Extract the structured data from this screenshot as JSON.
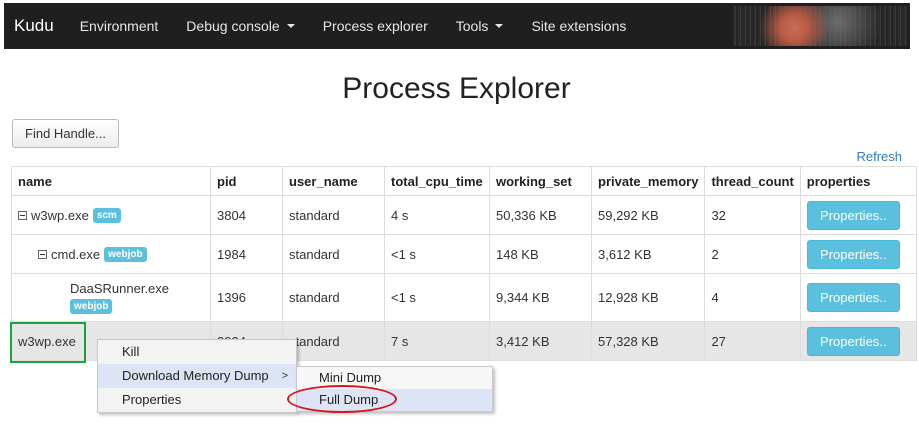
{
  "navbar": {
    "brand": "Kudu",
    "items": [
      {
        "label": "Environment",
        "dropdown": false
      },
      {
        "label": "Debug console",
        "dropdown": true
      },
      {
        "label": "Process explorer",
        "dropdown": false
      },
      {
        "label": "Tools",
        "dropdown": true
      },
      {
        "label": "Site extensions",
        "dropdown": false
      }
    ]
  },
  "page": {
    "title": "Process Explorer",
    "find_handle_label": "Find Handle...",
    "refresh_label": "Refresh"
  },
  "table": {
    "headers": [
      "name",
      "pid",
      "user_name",
      "total_cpu_time",
      "working_set",
      "private_memory",
      "thread_count",
      "properties"
    ],
    "rows": [
      {
        "name": "w3wp.exe",
        "badge": "scm",
        "pid": "3804",
        "user_name": "standard",
        "total_cpu_time": "4 s",
        "working_set": "50,336 KB",
        "private_memory": "59,292 KB",
        "thread_count": "32",
        "properties_label": "Properties.."
      },
      {
        "name": "cmd.exe",
        "badge": "webjob",
        "pid": "1984",
        "user_name": "standard",
        "total_cpu_time": "<1 s",
        "working_set": "148 KB",
        "private_memory": "3,612 KB",
        "thread_count": "2",
        "properties_label": "Properties.."
      },
      {
        "name": "DaaSRunner.exe",
        "badge": "webjob",
        "pid": "1396",
        "user_name": "standard",
        "total_cpu_time": "<1 s",
        "working_set": "9,344 KB",
        "private_memory": "12,928 KB",
        "thread_count": "4",
        "properties_label": "Properties.."
      },
      {
        "name": "w3wp.exe",
        "badge": "",
        "pid": "3924",
        "user_name": "standard",
        "total_cpu_time": "7 s",
        "working_set": "3,412 KB",
        "private_memory": "57,328 KB",
        "thread_count": "27",
        "properties_label": "Properties.."
      }
    ]
  },
  "context_menu": {
    "items": [
      "Kill",
      "Download Memory Dump",
      "Properties"
    ],
    "submenu_arrow": ">",
    "submenu": [
      "Mini Dump",
      "Full Dump"
    ]
  },
  "colors": {
    "navbar_bg": "#1f1f1f",
    "info_button": "#5bc0de",
    "link": "#337ab7",
    "highlight_green": "#1aa33a",
    "highlight_red": "#d8141c",
    "selected_row": "#e6e6e6"
  }
}
